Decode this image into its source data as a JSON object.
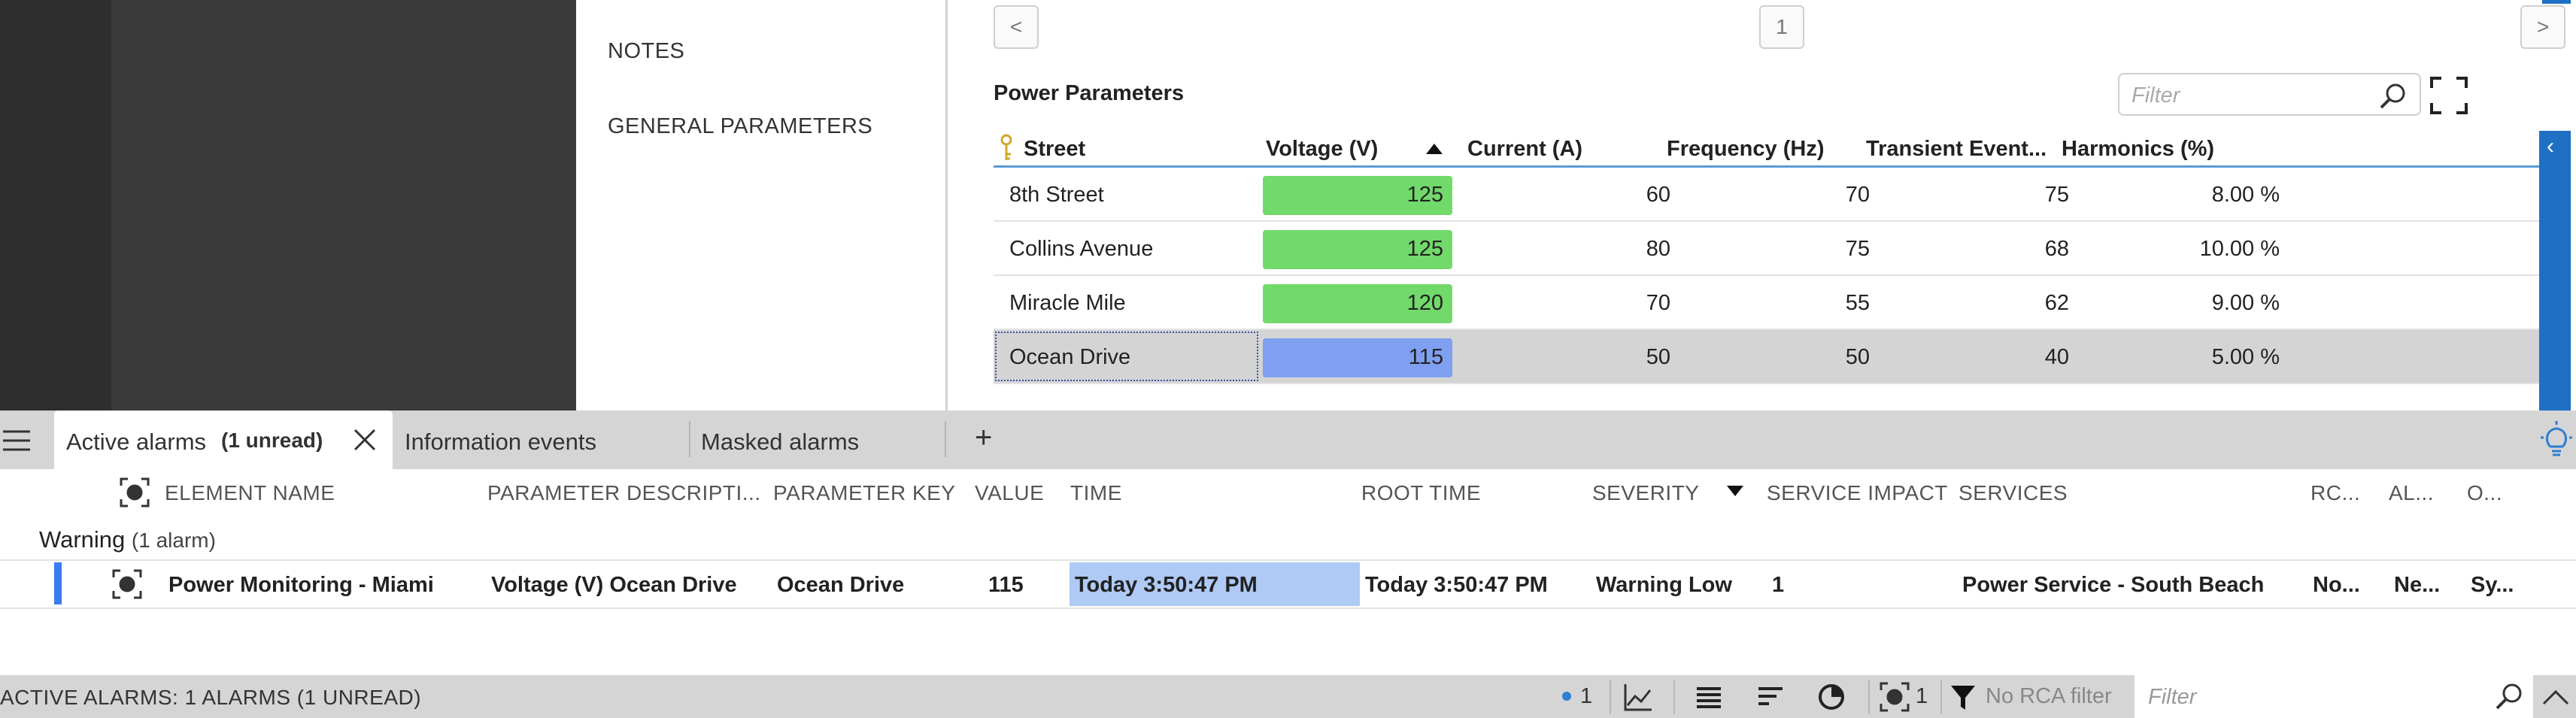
{
  "nav": {
    "items": [
      "NOTES",
      "GENERAL PARAMETERS"
    ]
  },
  "pager": {
    "prev": "<",
    "page": "1",
    "next": ">"
  },
  "power_parameters": {
    "title": "Power Parameters",
    "filter_placeholder": "Filter",
    "columns": [
      "Street",
      "Voltage (V)",
      "Current (A)",
      "Frequency (Hz)",
      "Transient Event...",
      "Harmonics (%)"
    ],
    "rows": [
      {
        "street": "8th Street",
        "voltage": "125",
        "current": "60",
        "frequency": "70",
        "transient": "75",
        "harmonics": "8.00 %",
        "voltage_color": "#72d96b"
      },
      {
        "street": "Collins Avenue",
        "voltage": "125",
        "current": "80",
        "frequency": "75",
        "transient": "68",
        "harmonics": "10.00 %",
        "voltage_color": "#72d96b"
      },
      {
        "street": "Miracle Mile",
        "voltage": "120",
        "current": "70",
        "frequency": "55",
        "transient": "62",
        "harmonics": "9.00 %",
        "voltage_color": "#72d96b"
      },
      {
        "street": "Ocean Drive",
        "voltage": "115",
        "current": "50",
        "frequency": "50",
        "transient": "40",
        "harmonics": "5.00 %",
        "voltage_color": "#7f9ff0",
        "selected": true
      }
    ]
  },
  "alarm_tabs": {
    "active_label": "Active alarms",
    "active_unread": "(1 unread)",
    "information_events": "Information events",
    "masked_alarms": "Masked alarms",
    "add": "+"
  },
  "alarm_table": {
    "headers": {
      "element_name": "ELEMENT NAME",
      "parameter_description": "PARAMETER DESCRIPTI...",
      "parameter_key": "PARAMETER KEY",
      "value": "VALUE",
      "time": "TIME",
      "root_time": "ROOT TIME",
      "severity": "SEVERITY",
      "service_impact": "SERVICE IMPACT",
      "services": "SERVICES",
      "rca": "RC...",
      "alarm_type": "AL...",
      "owner": "O..."
    },
    "group": {
      "label": "Warning",
      "count": "(1 alarm)"
    },
    "row": {
      "element_name": "Power Monitoring - Miami",
      "parameter_description": "Voltage (V) Ocean Drive",
      "parameter_key": "Ocean Drive",
      "value": "115",
      "time": "Today 3:50:47 PM",
      "root_time": "Today 3:50:47 PM",
      "severity": "Warning Low",
      "service_impact": "1",
      "services": "Power Service - South Beach",
      "rca": "No...",
      "alarm_type": "Ne...",
      "owner": "Sy..."
    }
  },
  "status_bar": {
    "text": "ACTIVE ALARMS: 1 ALARMS (1 UNREAD)",
    "unread_count": "1",
    "focus_count": "1",
    "rca_filter": "No RCA filter",
    "filter_placeholder": "Filter"
  },
  "colors": {
    "accent_blue": "#1f6fc5",
    "selection_blue": "#aecaf5",
    "warning_marker": "#3a7bf0"
  }
}
